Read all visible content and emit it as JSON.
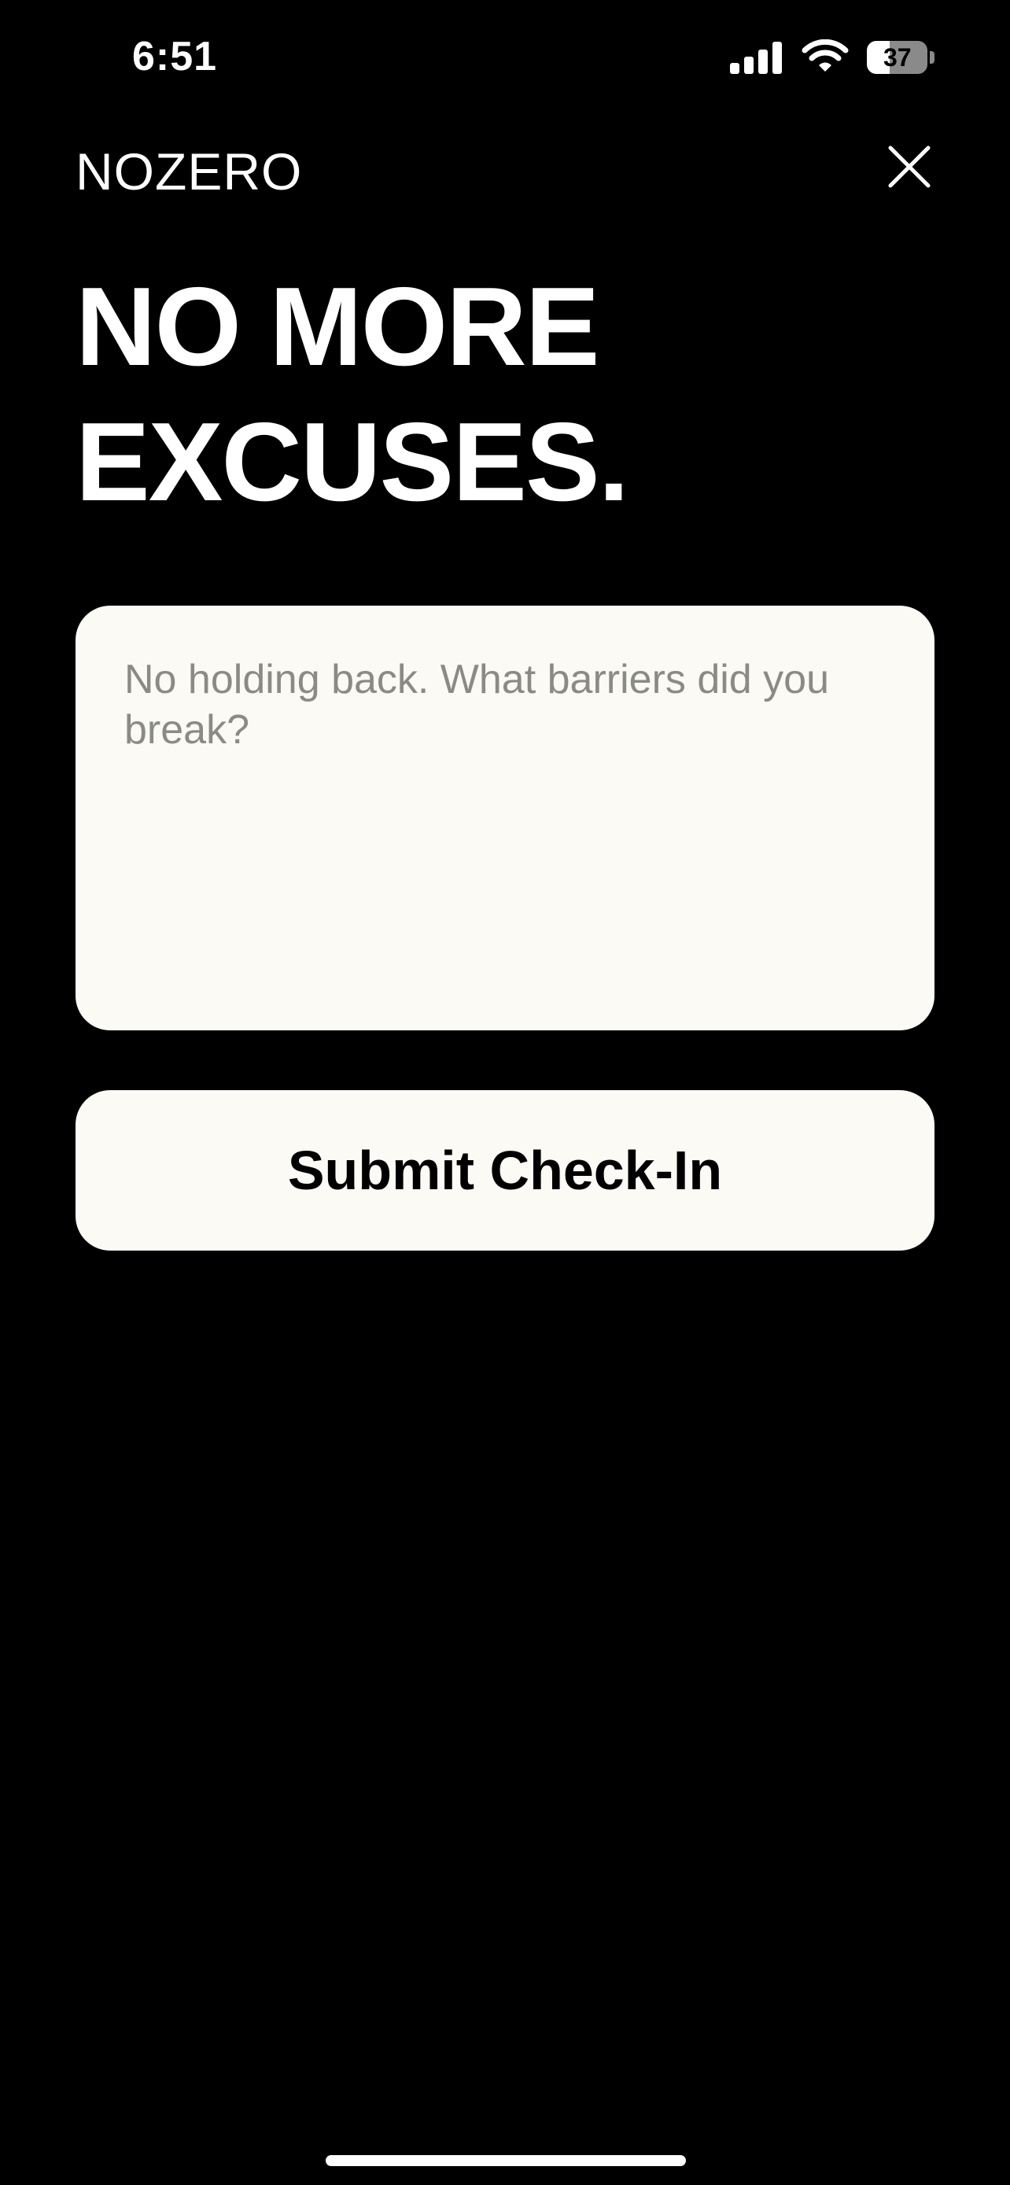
{
  "status_bar": {
    "time": "6:51",
    "battery_percent": "37",
    "battery_level": 0.37,
    "signal_icon": "cellular-signal-icon",
    "wifi_icon": "wifi-icon"
  },
  "header": {
    "brand": "NOZERO",
    "close_icon": "close-icon"
  },
  "headline": {
    "line1": "NO MORE",
    "line2": "EXCUSES."
  },
  "entry": {
    "value": "",
    "placeholder": "No holding back. What barriers did you break?"
  },
  "actions": {
    "submit_label": "Submit Check-In"
  },
  "colors": {
    "background": "#000000",
    "surface": "#fbfaf5",
    "placeholder": "#8a8a86",
    "text_light": "#ffffff",
    "text_dark": "#000000"
  }
}
